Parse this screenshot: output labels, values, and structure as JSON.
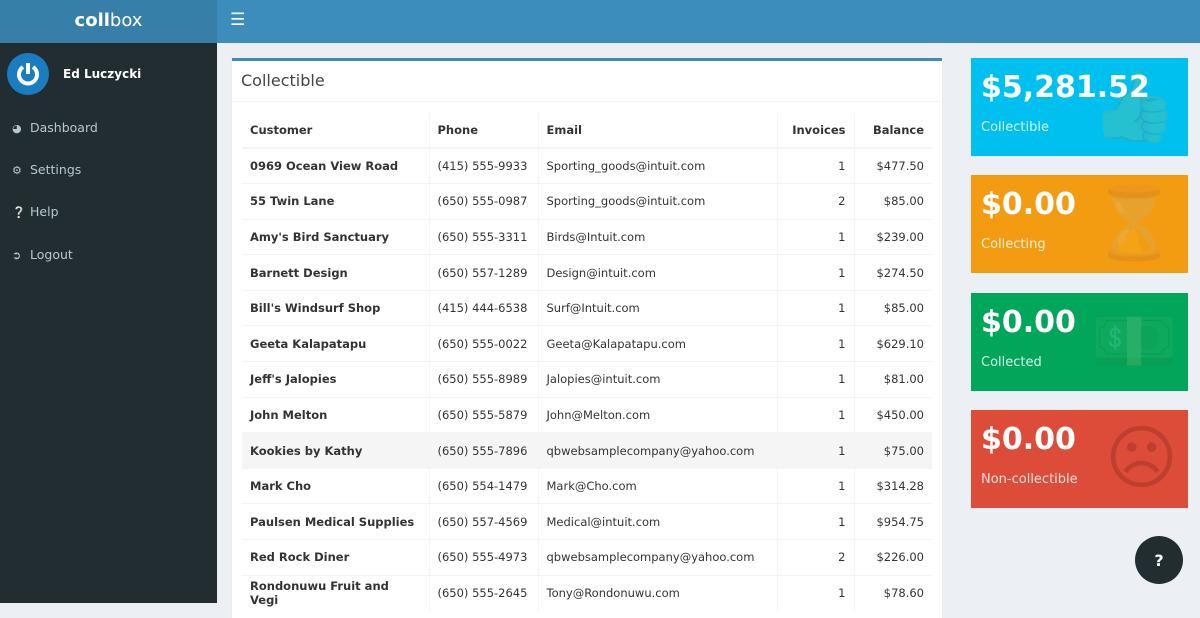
{
  "app": {
    "logo_bold": "coll",
    "logo_rest": "box"
  },
  "user": {
    "name": "Ed Luczycki"
  },
  "nav": [
    {
      "label": "Dashboard",
      "icon": "dashboard-icon"
    },
    {
      "label": "Settings",
      "icon": "gear-icon"
    },
    {
      "label": "Help",
      "icon": "question-icon"
    },
    {
      "label": "Logout",
      "icon": "logout-icon"
    }
  ],
  "table": {
    "title": "Collectible",
    "headers": [
      "Customer",
      "Phone",
      "Email",
      "Invoices",
      "Balance"
    ],
    "rows": [
      [
        "0969 Ocean View Road",
        "(415) 555-9933",
        "Sporting_goods@intuit.com",
        "1",
        "$477.50"
      ],
      [
        "55 Twin Lane",
        "(650) 555-0987",
        "Sporting_goods@intuit.com",
        "2",
        "$85.00"
      ],
      [
        "Amy's Bird Sanctuary",
        "(650) 555-3311",
        "Birds@Intuit.com",
        "1",
        "$239.00"
      ],
      [
        "Barnett Design",
        "(650) 557-1289",
        "Design@intuit.com",
        "1",
        "$274.50"
      ],
      [
        "Bill's Windsurf Shop",
        "(415) 444-6538",
        "Surf@Intuit.com",
        "1",
        "$85.00"
      ],
      [
        "Geeta Kalapatapu",
        "(650) 555-0022",
        "Geeta@Kalapatapu.com",
        "1",
        "$629.10"
      ],
      [
        "Jeff's Jalopies",
        "(650) 555-8989",
        "Jalopies@intuit.com",
        "1",
        "$81.00"
      ],
      [
        "John Melton",
        "(650) 555-5879",
        "John@Melton.com",
        "1",
        "$450.00"
      ],
      [
        "Kookies by Kathy",
        "(650) 555-7896",
        "qbwebsamplecompany@yahoo.com",
        "1",
        "$75.00"
      ],
      [
        "Mark Cho",
        "(650) 554-1479",
        "Mark@Cho.com",
        "1",
        "$314.28"
      ],
      [
        "Paulsen Medical Supplies",
        "(650) 557-4569",
        "Medical@intuit.com",
        "1",
        "$954.75"
      ],
      [
        "Red Rock Diner",
        "(650) 555-4973",
        "qbwebsamplecompany@yahoo.com",
        "2",
        "$226.00"
      ],
      [
        "Rondonuwu Fruit and Vegi",
        "(650) 555-2645",
        "Tony@Rondonuwu.com",
        "1",
        "$78.60"
      ]
    ]
  },
  "stats": [
    {
      "amount": "$5,281.52",
      "label": "Collectible",
      "color": "#00c0ef",
      "icon": "thumbs-up-icon"
    },
    {
      "amount": "$0.00",
      "label": "Collecting",
      "color": "#f39c12",
      "icon": "hourglass-icon"
    },
    {
      "amount": "$0.00",
      "label": "Collected",
      "color": "#00a65a",
      "icon": "money-icon"
    },
    {
      "amount": "$0.00",
      "label": "Non-collectible",
      "color": "#dd4b39",
      "icon": "frown-icon"
    }
  ],
  "help_button": "?"
}
